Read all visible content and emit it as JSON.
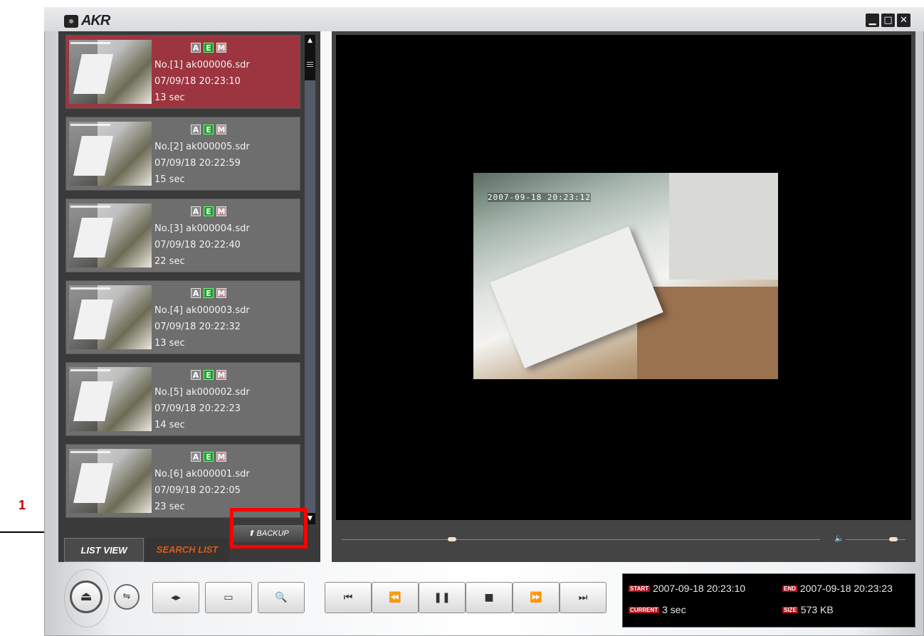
{
  "app": {
    "title": "AKR"
  },
  "window_controls": {
    "minimize": "▁",
    "maximize": "□",
    "close": "✕"
  },
  "recordings": [
    {
      "tags": [
        "A",
        "E",
        "M"
      ],
      "name": "No.[1] ak000006.sdr",
      "datetime": "07/09/18 20:23:10",
      "duration": "13 sec",
      "selected": true
    },
    {
      "tags": [
        "A",
        "E",
        "M"
      ],
      "name": "No.[2] ak000005.sdr",
      "datetime": "07/09/18 20:22:59",
      "duration": "15 sec",
      "selected": false
    },
    {
      "tags": [
        "A",
        "E",
        "M"
      ],
      "name": "No.[3] ak000004.sdr",
      "datetime": "07/09/18 20:22:40",
      "duration": "22 sec",
      "selected": false
    },
    {
      "tags": [
        "A",
        "E",
        "M"
      ],
      "name": "No.[4] ak000003.sdr",
      "datetime": "07/09/18 20:22:32",
      "duration": "13 sec",
      "selected": false
    },
    {
      "tags": [
        "A",
        "E",
        "M"
      ],
      "name": "No.[5] ak000002.sdr",
      "datetime": "07/09/18 20:22:23",
      "duration": "14 sec",
      "selected": false
    },
    {
      "tags": [
        "A",
        "E",
        "M"
      ],
      "name": "No.[6] ak000001.sdr",
      "datetime": "07/09/18 20:22:05",
      "duration": "23 sec",
      "selected": false
    }
  ],
  "tabs": {
    "list_view": "LIST VIEW",
    "search_list": "SEARCH LIST"
  },
  "backup": {
    "label": "BACKUP",
    "icon": "⬆"
  },
  "video": {
    "osd_timestamp": "2007-09-18 20:23:12",
    "playback_fraction": 0.23,
    "volume_fraction": 0.8
  },
  "controls": {
    "eject": "⏏",
    "network": "⇋",
    "step": "◂▸",
    "window": "▭",
    "search": "🔍",
    "first": "⏮",
    "rewind": "⏪",
    "pause": "❚❚",
    "stop": "■",
    "forward": "⏩",
    "last": "⏭"
  },
  "info": {
    "start_label": "START",
    "start_value": "2007-09-18 20:23:10",
    "end_label": "END",
    "end_value": "2007-09-18 20:23:23",
    "current_label": "CURRENT",
    "current_value": "3 sec",
    "size_label": "SIZE",
    "size_value": "573 KB"
  },
  "annotation": {
    "number": "1"
  },
  "colors": {
    "selected": "#9c3540",
    "accent_tab": "#e05a10",
    "callout": "#ff0000"
  }
}
